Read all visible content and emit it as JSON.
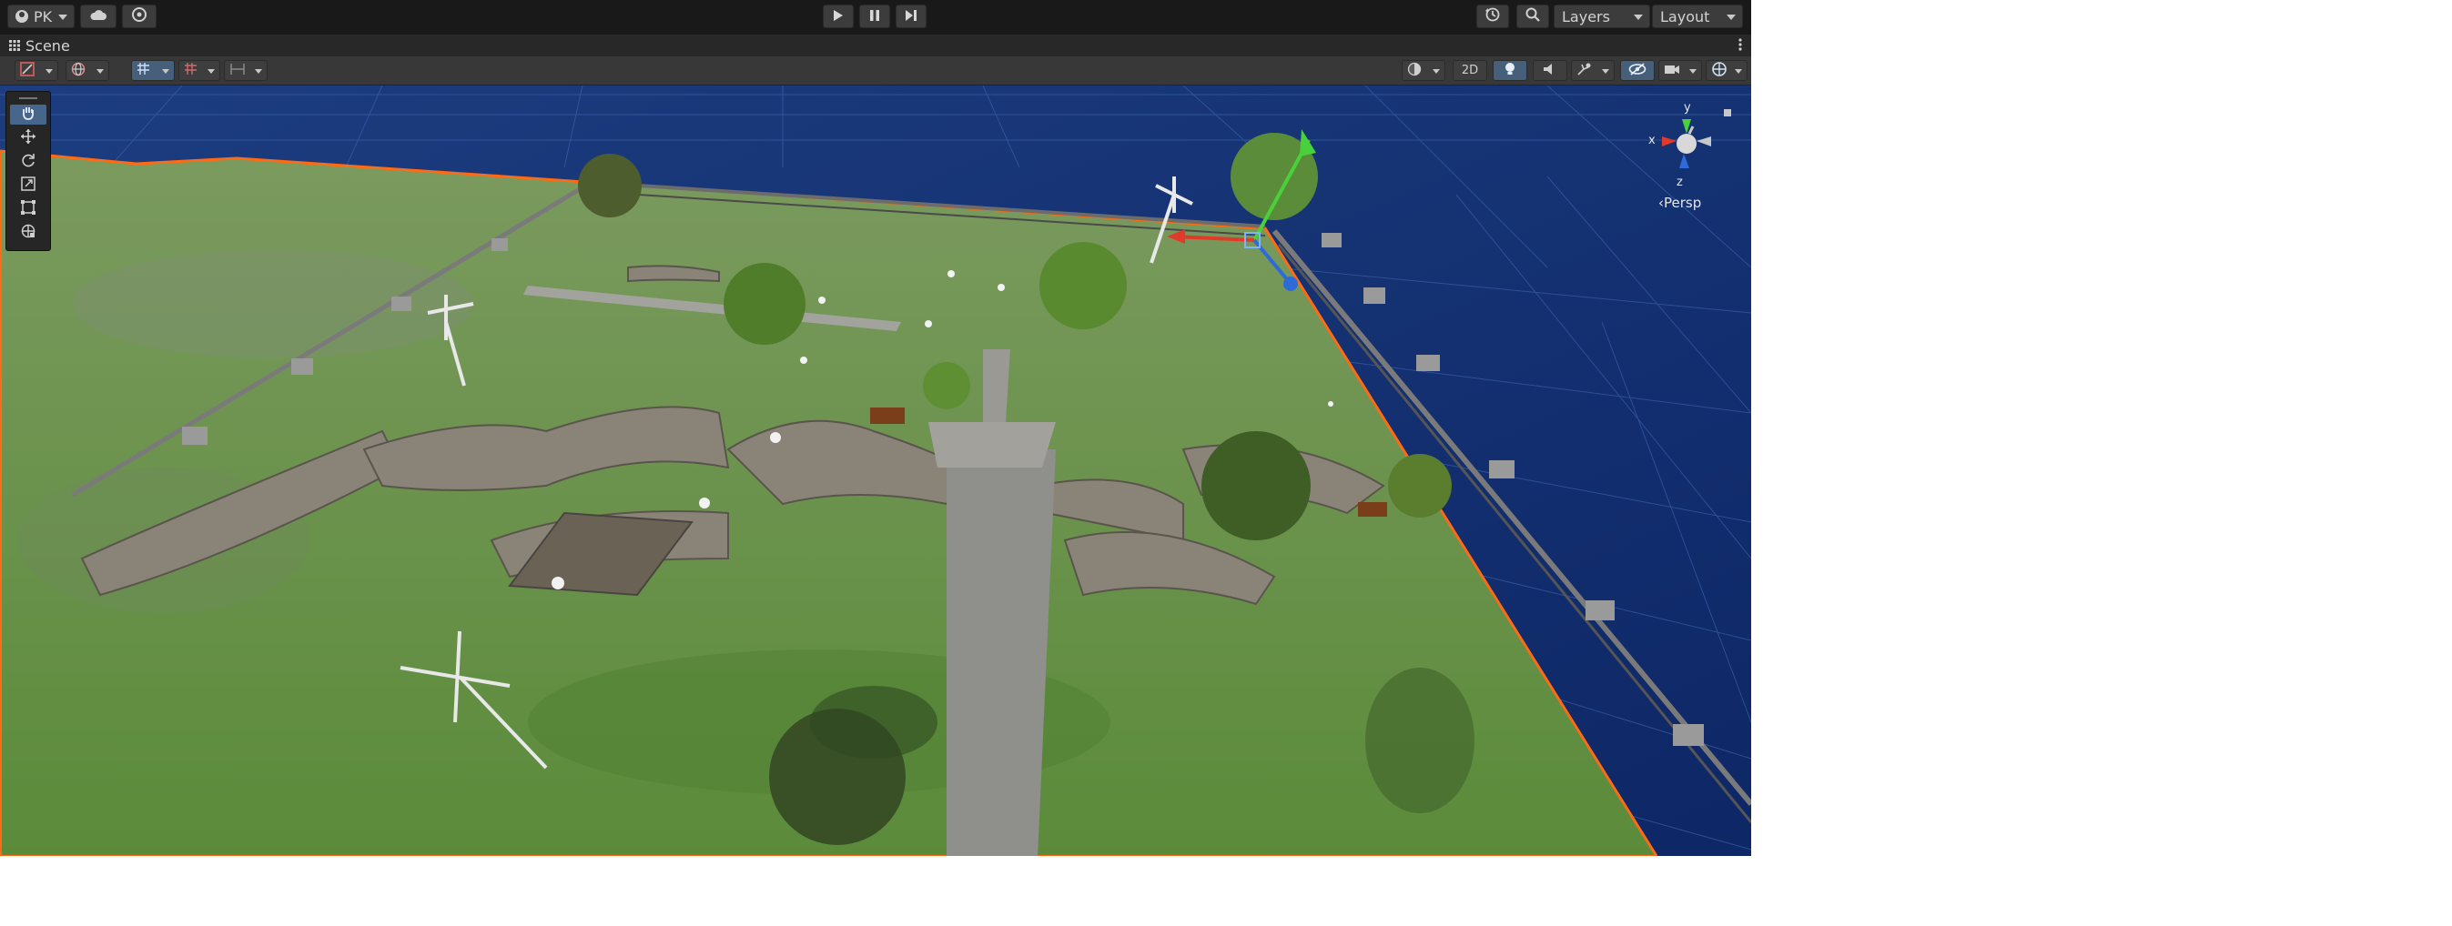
{
  "toolbar": {
    "account_label": "PK",
    "layers_label": "Layers",
    "layout_label": "Layout"
  },
  "scene_tab": {
    "title": "Scene"
  },
  "scene_toolbar": {
    "two_d_label": "2D"
  },
  "gizmo": {
    "y_label": "y",
    "x_label": "x",
    "z_label": "z",
    "projection_label": "‹Persp"
  },
  "colors": {
    "editor_bg": "#191919",
    "toolbar_button": "#3c3c3c",
    "active_blue": "#47668c",
    "water": "#1a3a7a",
    "grass": "#5e8a3c",
    "selection_outline": "#ff6a14",
    "axis_x": "#e23a2a",
    "axis_y": "#48d13a",
    "axis_z": "#2e6bd9"
  }
}
